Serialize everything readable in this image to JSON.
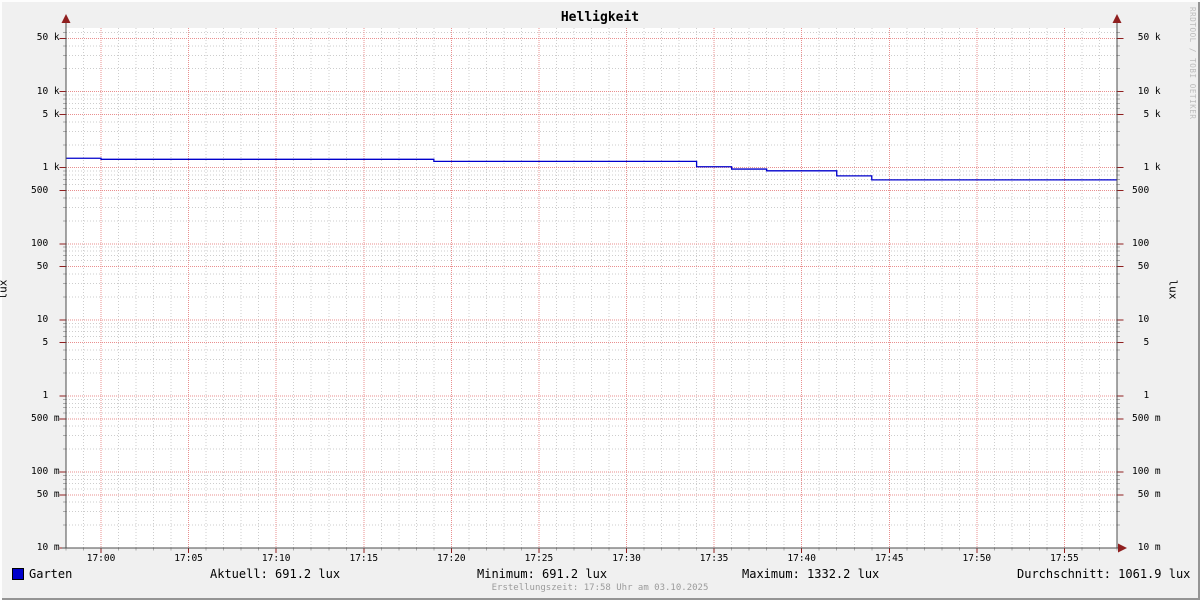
{
  "title": "Helligkeit",
  "watermark": "RRDTOOL / TOBI OETIKER",
  "y_axis": {
    "unit_left": "lux",
    "unit_right": "lux"
  },
  "legend": {
    "series_label": "Garten",
    "aktuell": "Aktuell: 691.2 lux",
    "minimum": "Minimum: 691.2 lux",
    "maximum": "Maximum: 1332.2 lux",
    "durchschnitt": "Durchschnitt: 1061.9 lux",
    "creation": "Erstellungszeit: 17:58 Uhr am 03.10.2025"
  },
  "colors": {
    "series": "#0000cc",
    "grid_major": "#e98f8f",
    "grid_minor": "#cdcdcd",
    "minor_tick": "#aaaaaa",
    "axis": "#4c4c4c",
    "arrow": "#8f1f1f",
    "canvas": "#ffffff",
    "background": "#f0f0f0"
  },
  "chart_data": {
    "type": "line",
    "title": "Helligkeit",
    "xlabel": "",
    "ylabel": "lux",
    "y_scale": "log",
    "ylim": [
      0.01,
      70000
    ],
    "grid": true,
    "legend_position": "bottom",
    "x_start": "16:58",
    "x_end": "17:58",
    "x_ticks": [
      "17:00",
      "17:05",
      "17:10",
      "17:15",
      "17:20",
      "17:25",
      "17:30",
      "17:35",
      "17:40",
      "17:45",
      "17:50",
      "17:55"
    ],
    "y_ticks": [
      {
        "value": 50000,
        "label": "50 k"
      },
      {
        "value": 10000,
        "label": "10 k"
      },
      {
        "value": 5000,
        "label": "5 k"
      },
      {
        "value": 1000,
        "label": "1 k"
      },
      {
        "value": 500,
        "label": "500"
      },
      {
        "value": 100,
        "label": "100"
      },
      {
        "value": 50,
        "label": "50"
      },
      {
        "value": 10,
        "label": "10"
      },
      {
        "value": 5,
        "label": "5"
      },
      {
        "value": 1,
        "label": "1"
      },
      {
        "value": 0.5,
        "label": "500 m"
      },
      {
        "value": 0.1,
        "label": "100 m"
      },
      {
        "value": 0.05,
        "label": "50 m"
      },
      {
        "value": 0.01,
        "label": "10 m"
      }
    ],
    "series": [
      {
        "name": "Garten",
        "color": "#0000cc",
        "style": "step",
        "points": [
          {
            "time": "16:58",
            "lux": 1332.2
          },
          {
            "time": "17:00",
            "lux": 1290
          },
          {
            "time": "17:19",
            "lux": 1210
          },
          {
            "time": "17:34",
            "lux": 1030
          },
          {
            "time": "17:36",
            "lux": 960
          },
          {
            "time": "17:38",
            "lux": 910
          },
          {
            "time": "17:42",
            "lux": 780
          },
          {
            "time": "17:44",
            "lux": 691.2
          },
          {
            "time": "17:58",
            "lux": 691.2
          }
        ]
      }
    ],
    "stats": {
      "aktuell_lux": 691.2,
      "minimum_lux": 691.2,
      "maximum_lux": 1332.2,
      "durchschnitt_lux": 1061.9
    }
  }
}
